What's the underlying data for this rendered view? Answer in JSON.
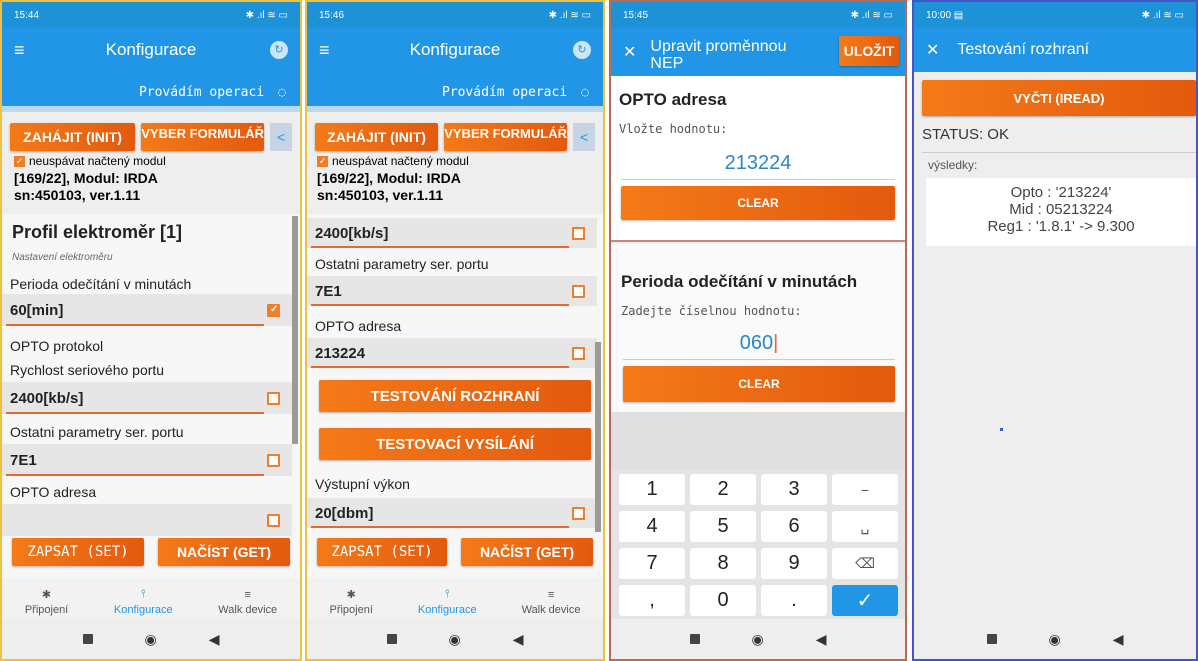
{
  "screens": {
    "s1": {
      "time": "15:44",
      "title": "Konfigurace",
      "operation": "Provádím operaci",
      "init_btn": "ZAHÁJIT (INIT)",
      "form_btn": "VYBER FORMULÁŘ",
      "checkbox_label": "neuspávat načtený modul",
      "module": "[169/22], Modul: IRDA",
      "sn": "sn:450103, ver.1.11",
      "profile_title": "Profil elektroměr [1]",
      "profile_sub": "Nastavení elektroměru",
      "f1_label": "Perioda odečítání v minutách",
      "f1_value": "60[min]",
      "f2_label": "OPTO protokol",
      "f3_label": "Rychlost seriového portu",
      "f3_value": "2400[kb/s]",
      "f4_label": "Ostatni parametry ser. portu",
      "f4_value": "7E1",
      "f5_label": "OPTO adresa",
      "set_btn": "ZAPSAT (SET)",
      "get_btn": "NAČÍST (GET)",
      "nav": [
        "Připojení",
        "Konfigurace",
        "Walk device"
      ]
    },
    "s2": {
      "time": "15:46",
      "title": "Konfigurace",
      "operation": "Provádím operaci",
      "init_btn": "ZAHÁJIT (INIT)",
      "form_btn": "VYBER FORMULÁŘ",
      "checkbox_label": "neuspávat načtený modul",
      "module": "[169/22], Modul: IRDA",
      "sn": "sn:450103, ver.1.11",
      "f0_value": "2400[kb/s]",
      "f1_label": "Ostatni parametry ser. portu",
      "f1_value": "7E1",
      "f2_label": "OPTO adresa",
      "f2_value": "213224",
      "test_iface_btn": "TESTOVÁNÍ ROZHRANÍ",
      "test_tx_btn": "TESTOVACÍ VYSÍLÁNÍ",
      "f3_label": "Výstupní výkon",
      "f3_value": "20[dbm]",
      "set_btn": "ZAPSAT (SET)",
      "get_btn": "NAČÍST (GET)",
      "nav": [
        "Připojení",
        "Konfigurace",
        "Walk device"
      ]
    },
    "s3": {
      "time": "15:45",
      "title": "Upravit proměnnou NEP",
      "save_btn": "ULOŽIT",
      "dlg1_title": "OPTO adresa",
      "dlg1_prompt": "Vložte hodnotu:",
      "dlg1_value": "213224",
      "clear1": "CLEAR",
      "dlg2_title": "Perioda odečítání v minutách",
      "dlg2_prompt": "Zadejte číselnou hodnotu:",
      "dlg2_value": "060",
      "clear2": "CLEAR",
      "keys": [
        "1",
        "2",
        "3",
        "−",
        "4",
        "5",
        "6",
        "␣",
        "7",
        "8",
        "9",
        "⌫",
        ",",
        "0",
        ".",
        "✓"
      ]
    },
    "s4": {
      "time": "10:00",
      "title": "Testování rozhraní",
      "read_btn": "VYČTI (IREAD)",
      "status": "STATUS: OK",
      "results_label": "výsledky:",
      "results": [
        "Opto : '213224'",
        "Mid : 05213224",
        "Reg1 : '1.8.1' -> 9.300"
      ]
    }
  },
  "colors": {
    "accent": "#f47a18",
    "primary": "#2196e6"
  }
}
